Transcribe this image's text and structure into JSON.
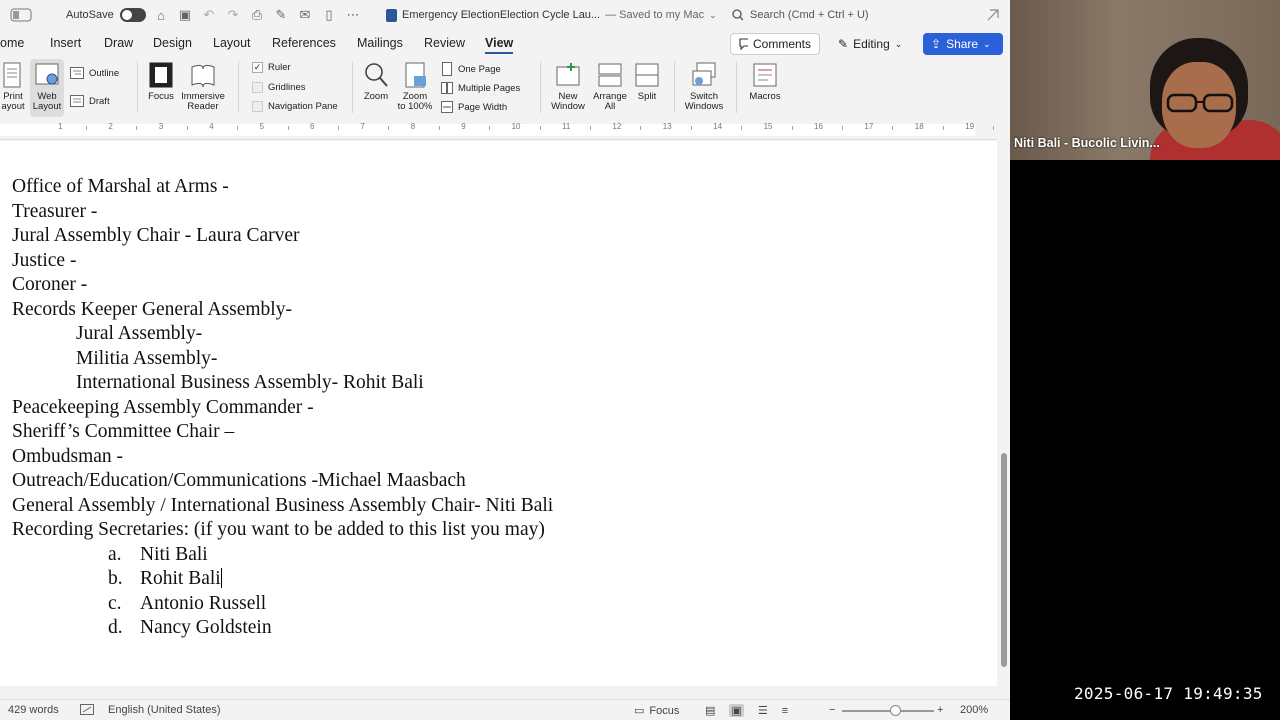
{
  "titlebar": {
    "autosave_label": "AutoSave",
    "doc_title": "Emergency ElectionElection Cycle Lau...",
    "saved_status": "— Saved to my Mac",
    "search_placeholder": "Search (Cmd + Ctrl + U)"
  },
  "tabs": [
    "ome",
    "Insert",
    "Draw",
    "Design",
    "Layout",
    "References",
    "Mailings",
    "Review",
    "View"
  ],
  "active_tab": "View",
  "actions": {
    "comments": "Comments",
    "editing": "Editing",
    "share": "Share"
  },
  "ribbon": {
    "print_layout": [
      "Print",
      "ayout"
    ],
    "web_layout": [
      "Web",
      "Layout"
    ],
    "outline": "Outline",
    "draft": "Draft",
    "focus": "Focus",
    "immersive_reader": [
      "Immersive",
      "Reader"
    ],
    "ruler": "Ruler",
    "gridlines": "Gridlines",
    "navigation_pane": "Navigation Pane",
    "zoom": "Zoom",
    "zoom_100": [
      "Zoom",
      "to 100%"
    ],
    "one_page": "One Page",
    "multiple_pages": "Multiple Pages",
    "page_width": "Page Width",
    "new_window": [
      "New",
      "Window"
    ],
    "arrange_all": [
      "Arrange",
      "All"
    ],
    "split": "Split",
    "switch_windows": [
      "Switch",
      "Windows"
    ],
    "macros": "Macros"
  },
  "ruler_numbers": [
    "1",
    "2",
    "3",
    "4",
    "5",
    "6",
    "7",
    "8",
    "9",
    "10",
    "11",
    "12",
    "13",
    "14",
    "15",
    "16",
    "17",
    "18",
    "19"
  ],
  "document": {
    "lines": [
      {
        "text": "Office of Marshal at Arms -",
        "indent": 0
      },
      {
        "text": "Treasurer  -",
        "indent": 0
      },
      {
        "text": "Jural Assembly Chair - Laura Carver",
        "indent": 0
      },
      {
        "text": "Justice -",
        "indent": 0
      },
      {
        "text": "Coroner -",
        "indent": 0
      },
      {
        "text": "Records Keeper General Assembly-",
        "indent": 0
      },
      {
        "text": "Jural Assembly-",
        "indent": 1
      },
      {
        "text": "Militia Assembly-",
        "indent": 1
      },
      {
        "text": "International Business Assembly- Rohit Bali",
        "indent": 1
      },
      {
        "text": "Peacekeeping Assembly Commander -",
        "indent": 0
      },
      {
        "text": "Sheriff’s Committee Chair –",
        "indent": 0
      },
      {
        "text": "Ombudsman -",
        "indent": 0
      },
      {
        "text": "Outreach/Education/Communications -Michael Maasbach",
        "indent": 0
      },
      {
        "text": "General Assembly / International Business Assembly Chair- Niti Bali",
        "indent": 0
      },
      {
        "text": "Recording Secretaries: (if you want to be added to this list you may)",
        "indent": 0
      }
    ],
    "list": [
      {
        "marker": "a.",
        "text": "Niti Bali"
      },
      {
        "marker": "b.",
        "text": "Rohit Bali"
      },
      {
        "marker": "c.",
        "text": "Antonio Russell"
      },
      {
        "marker": "d.",
        "text": "Nancy Goldstein"
      }
    ]
  },
  "status": {
    "word_count": "429 words",
    "language": "English (United States)",
    "focus": "Focus",
    "zoom_level": "200%"
  },
  "video": {
    "participant_name": "Niti Bali - Bucolic Livin..."
  },
  "timestamp": "2025-06-17 19:49:35",
  "colors": {
    "accent": "#2b579a",
    "share": "#2b61d8"
  }
}
